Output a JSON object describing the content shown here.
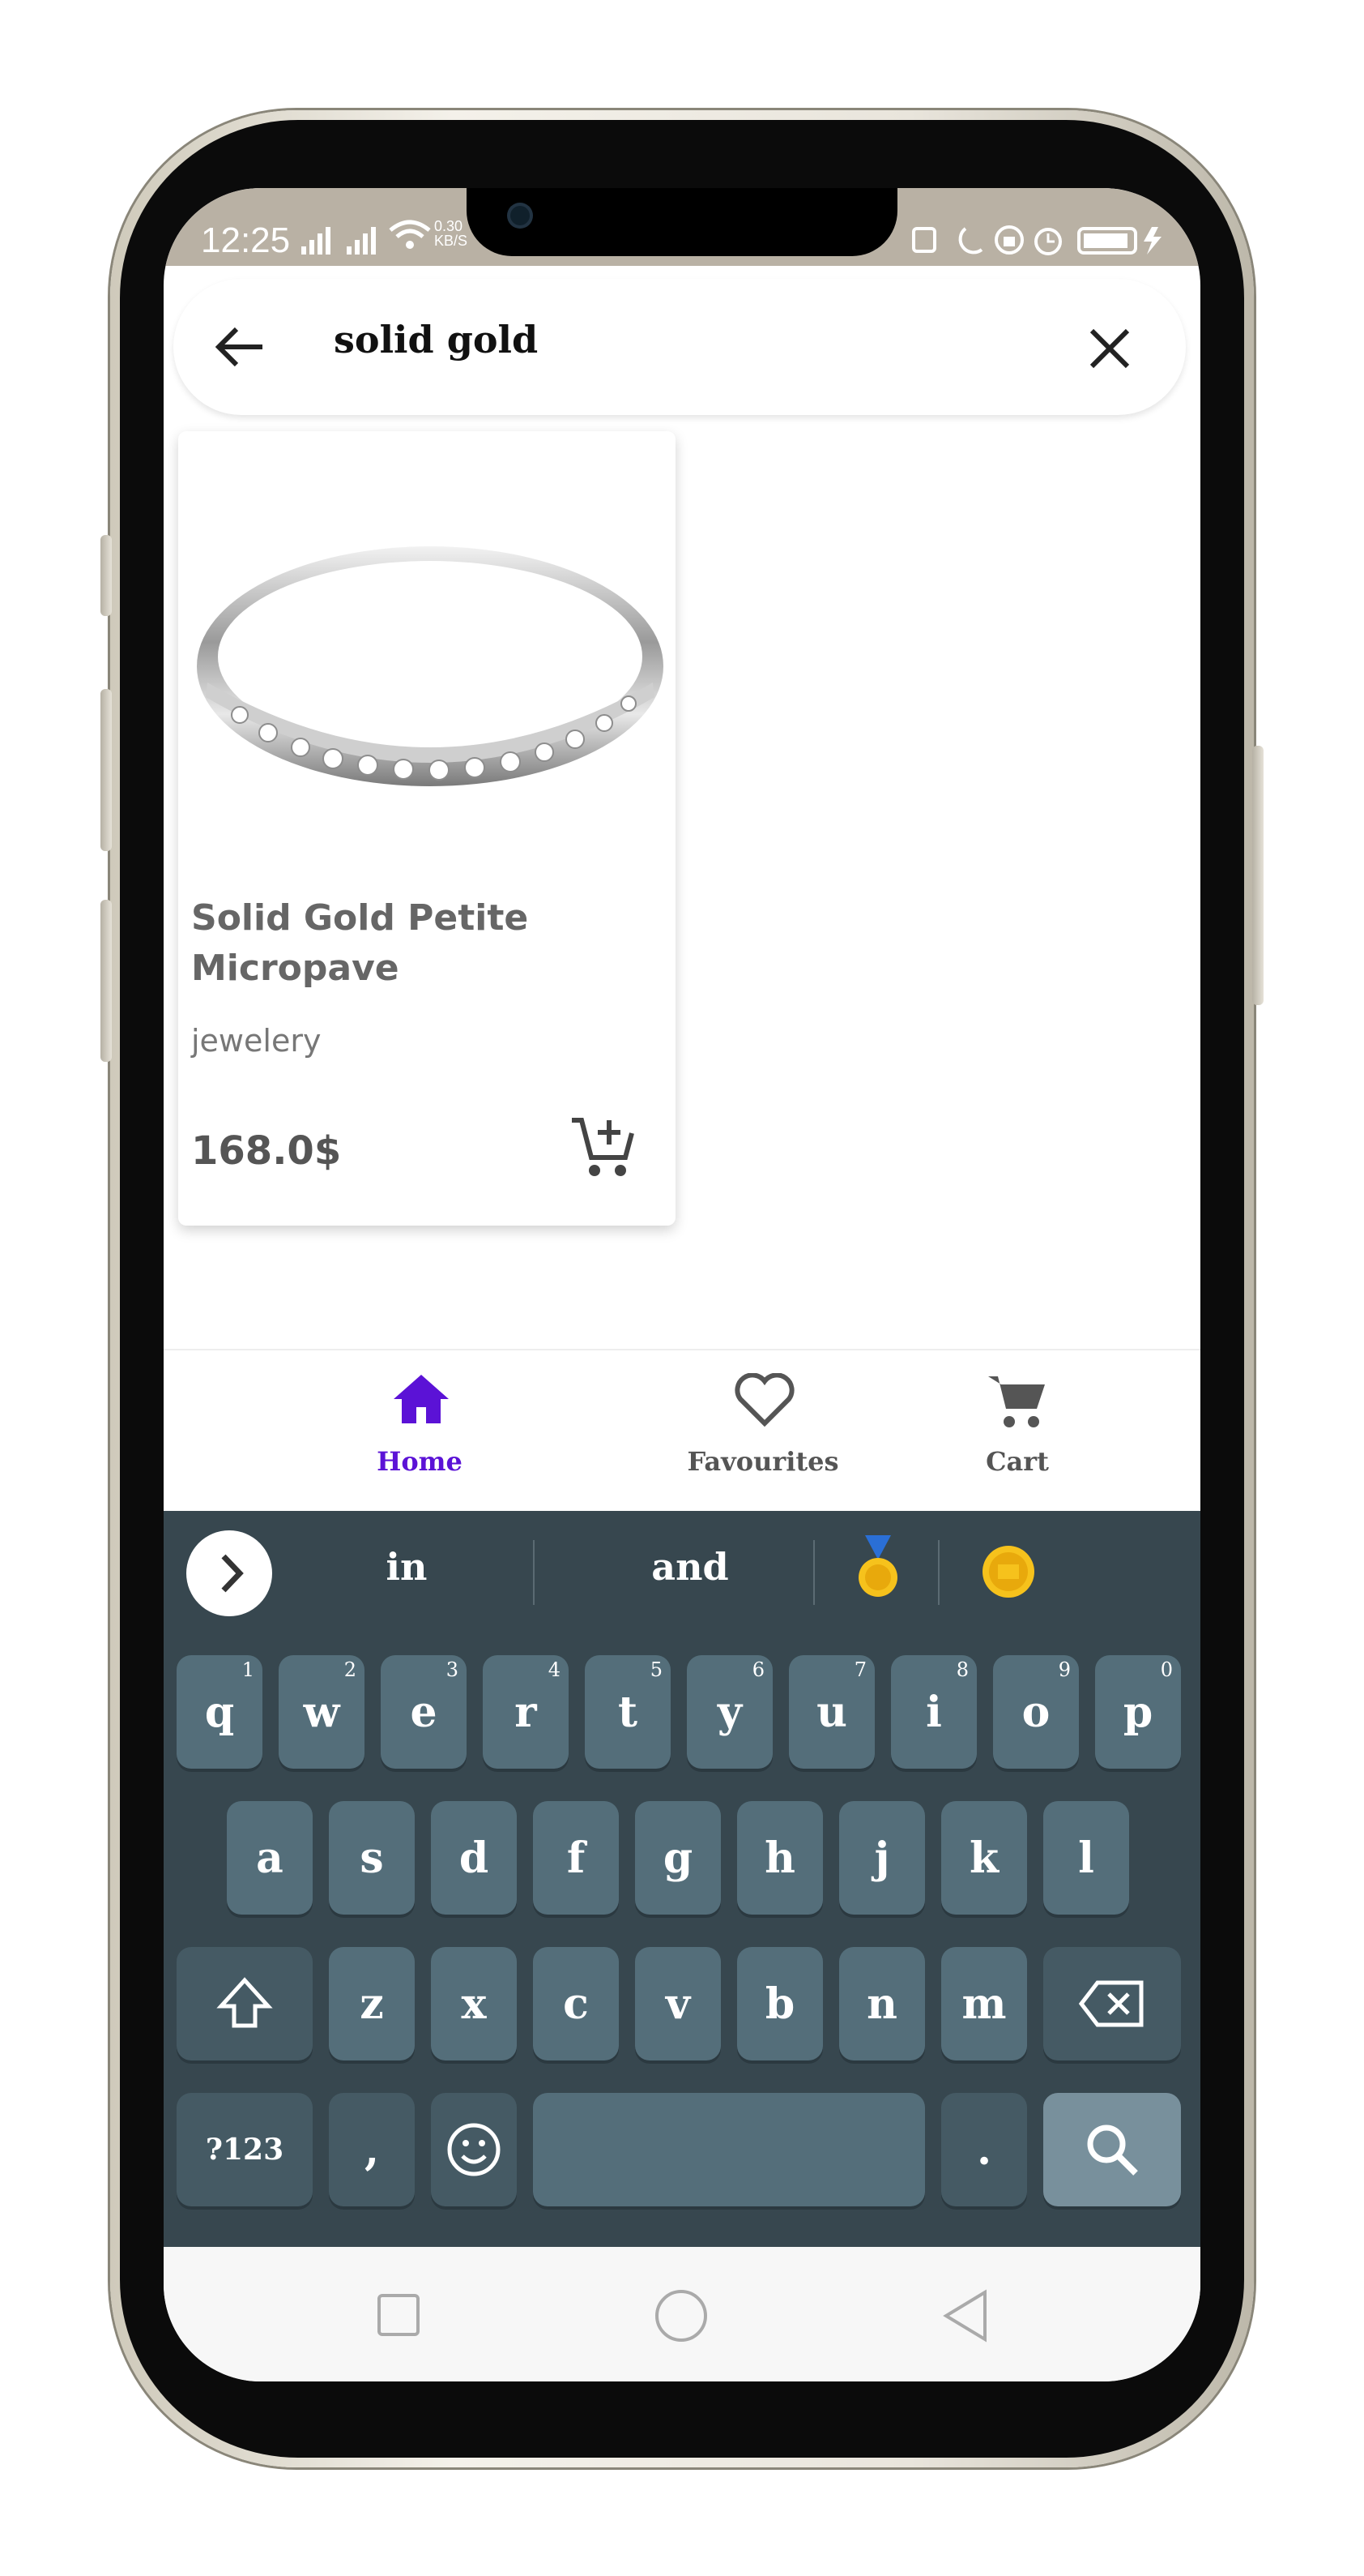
{
  "status_bar": {
    "time": "12:25",
    "network_speed_value": "0.30",
    "network_speed_unit": "KB/S"
  },
  "search": {
    "query": "solid gold",
    "back_icon": "arrow-left-icon",
    "clear_icon": "close-icon"
  },
  "product": {
    "image_icon": "ring-image",
    "title": "Solid Gold Petite Micropave",
    "category": "jewelery",
    "price": "168.0$",
    "add_to_cart_icon": "add-shopping-cart-icon"
  },
  "bottom_nav": {
    "items": [
      {
        "label": "Home",
        "icon": "home-icon",
        "active": true
      },
      {
        "label": "Favourites",
        "icon": "heart-outline-icon",
        "active": false
      },
      {
        "label": "Cart",
        "icon": "shopping-cart-icon",
        "active": false
      }
    ],
    "active_color": "#5b12d6",
    "inactive_color": "#555555"
  },
  "keyboard": {
    "suggestions": [
      "in",
      "and"
    ],
    "suggestion_emoji": [
      "gold-medal-emoji",
      "coin-emoji"
    ],
    "row1": [
      {
        "key": "q",
        "alt": "1"
      },
      {
        "key": "w",
        "alt": "2"
      },
      {
        "key": "e",
        "alt": "3"
      },
      {
        "key": "r",
        "alt": "4"
      },
      {
        "key": "t",
        "alt": "5"
      },
      {
        "key": "y",
        "alt": "6"
      },
      {
        "key": "u",
        "alt": "7"
      },
      {
        "key": "i",
        "alt": "8"
      },
      {
        "key": "o",
        "alt": "9"
      },
      {
        "key": "p",
        "alt": "0"
      }
    ],
    "row2": [
      "a",
      "s",
      "d",
      "f",
      "g",
      "h",
      "j",
      "k",
      "l"
    ],
    "row3": [
      "z",
      "x",
      "c",
      "v",
      "b",
      "n",
      "m"
    ],
    "symbols_label": "?123",
    "comma_label": ",",
    "period_label": ".",
    "background": "#37474f",
    "key_color": "#546e7a",
    "search_key_color": "#78909c"
  }
}
